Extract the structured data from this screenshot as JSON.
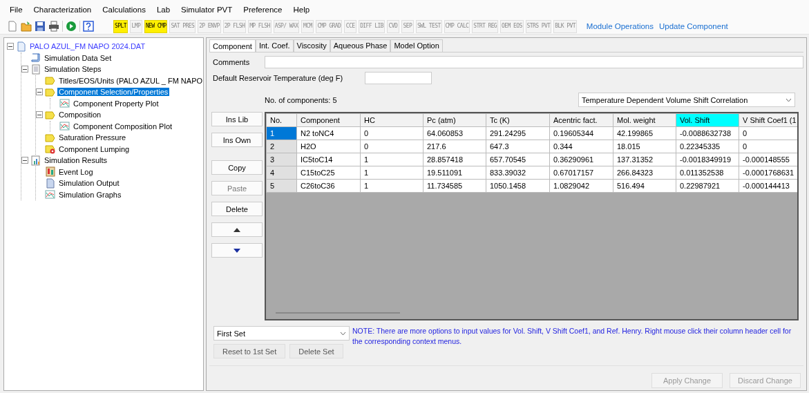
{
  "menu": [
    "File",
    "Characterization",
    "Calculations",
    "Lab",
    "Simulator PVT",
    "Preference",
    "Help"
  ],
  "toolbar": {
    "icons": [
      {
        "kind": "new"
      },
      {
        "kind": "open"
      },
      {
        "kind": "save"
      },
      {
        "kind": "print"
      },
      {
        "kind": "run"
      },
      {
        "kind": "help"
      }
    ],
    "tools": [
      {
        "label": "SPLT",
        "highlighted": true,
        "disabled": false
      },
      {
        "label": "LMP",
        "highlighted": false,
        "disabled": true
      },
      {
        "label": "NEW CMP",
        "highlighted": true,
        "disabled": false
      },
      {
        "label": "SAT PRES",
        "highlighted": false,
        "disabled": true
      },
      {
        "label": "2P ENVP",
        "highlighted": false,
        "disabled": true
      },
      {
        "label": "2P FLSH",
        "highlighted": false,
        "disabled": true
      },
      {
        "label": "MP FLSH",
        "highlighted": false,
        "disabled": true
      },
      {
        "label": "ASP/ WAX",
        "highlighted": false,
        "disabled": true
      },
      {
        "label": "MCM",
        "highlighted": false,
        "disabled": true
      },
      {
        "label": "CMP GRAD",
        "highlighted": false,
        "disabled": true
      },
      {
        "label": "CCE",
        "highlighted": false,
        "disabled": true
      },
      {
        "label": "DIFF LIB",
        "highlighted": false,
        "disabled": true
      },
      {
        "label": "CVD",
        "highlighted": false,
        "disabled": true
      },
      {
        "label": "SEP",
        "highlighted": false,
        "disabled": true
      },
      {
        "label": "SWL TEST",
        "highlighted": false,
        "disabled": true
      },
      {
        "label": "CMP CALC",
        "highlighted": false,
        "disabled": true
      },
      {
        "label": "STRT REG",
        "highlighted": false,
        "disabled": true
      },
      {
        "label": "OEM EOS",
        "highlighted": false,
        "disabled": true
      },
      {
        "label": "STRS PVT",
        "highlighted": false,
        "disabled": true
      },
      {
        "label": "BLK PVT",
        "highlighted": false,
        "disabled": true
      }
    ],
    "links": [
      "Module Operations",
      "Update Component"
    ]
  },
  "tree": [
    {
      "label": "PALO AZUL_FM NAPO 2024.DAT",
      "kind": "file",
      "expanded": true,
      "selected": false,
      "children": [
        {
          "label": "Simulation Data Set",
          "kind": "dataset",
          "selected": false
        },
        {
          "label": "Simulation Steps",
          "kind": "document",
          "expanded": true,
          "selected": false,
          "children": [
            {
              "label": "Titles/EOS/Units (PALO AZUL _ FM NAPO",
              "kind": "step",
              "selected": false
            },
            {
              "label": "Component Selection/Properties",
              "kind": "step",
              "expanded": true,
              "selected": true,
              "children": [
                {
                  "label": "Component Property Plot",
                  "kind": "plot",
                  "selected": false
                }
              ]
            },
            {
              "label": "Composition",
              "kind": "step",
              "expanded": true,
              "selected": false,
              "children": [
                {
                  "label": "Component Composition Plot",
                  "kind": "plot",
                  "selected": false
                }
              ]
            },
            {
              "label": "Saturation Pressure",
              "kind": "step",
              "selected": false
            },
            {
              "label": "Component Lumping",
              "kind": "error",
              "selected": false
            }
          ]
        },
        {
          "label": "Simulation Results",
          "kind": "results",
          "expanded": true,
          "selected": false,
          "children": [
            {
              "label": "Event Log",
              "kind": "log",
              "selected": false
            },
            {
              "label": "Simulation Output",
              "kind": "output",
              "selected": false
            },
            {
              "label": "Simulation Graphs",
              "kind": "plot",
              "selected": false
            }
          ]
        }
      ]
    }
  ],
  "tabs": [
    {
      "label": "Component",
      "selected": true
    },
    {
      "label": "Int. Coef.",
      "selected": false
    },
    {
      "label": "Viscosity",
      "selected": false
    },
    {
      "label": "Aqueous Phase",
      "selected": false
    },
    {
      "label": "Model Option",
      "selected": false
    }
  ],
  "comments_label": "Comments",
  "temperature_label": "Default Reservoir Temperature (deg F)",
  "component_count": "No. of components: 5",
  "correlation_dropdown": "Temperature Dependent Volume Shift Correlation",
  "side_buttons": [
    {
      "label": "Ins Lib",
      "kind": "text",
      "disabled": false
    },
    {
      "label": "Ins Own",
      "kind": "text",
      "disabled": false
    },
    {
      "label": "Copy",
      "kind": "text",
      "disabled": false
    },
    {
      "label": "Paste",
      "kind": "text",
      "disabled": true
    },
    {
      "label": "Delete",
      "kind": "text",
      "disabled": false
    },
    {
      "kind": "up",
      "disabled": false
    },
    {
      "kind": "down",
      "disabled": false
    }
  ],
  "table": {
    "columns": [
      {
        "label": "No.",
        "highlighted": false
      },
      {
        "label": "Component",
        "highlighted": false
      },
      {
        "label": "HC",
        "highlighted": false
      },
      {
        "label": "Pc (atm)",
        "highlighted": false
      },
      {
        "label": "Tc (K)",
        "highlighted": false
      },
      {
        "label": "Acentric fact.",
        "highlighted": false
      },
      {
        "label": "Mol. weight",
        "highlighted": false
      },
      {
        "label": "Vol. Shift",
        "highlighted": true
      },
      {
        "label": "V Shift Coef1 (1",
        "highlighted": false
      }
    ],
    "rows": [
      {
        "selected": true,
        "cells": [
          "1",
          "N2 toNC4",
          "0",
          "64.060853",
          "291.24295",
          "0.19605344",
          "42.199865",
          "-0.0088632738",
          "0"
        ]
      },
      {
        "selected": false,
        "cells": [
          "2",
          "H2O",
          "0",
          "217.6",
          "647.3",
          "0.344",
          "18.015",
          "0.22345335",
          "0"
        ]
      },
      {
        "selected": false,
        "cells": [
          "3",
          "IC5toC14",
          "1",
          "28.857418",
          "657.70545",
          "0.36290961",
          "137.31352",
          "-0.0018349919",
          "-0.000148555"
        ]
      },
      {
        "selected": false,
        "cells": [
          "4",
          "C15toC25",
          "1",
          "19.511091",
          "833.39032",
          "0.67017157",
          "266.84323",
          "0.011352538",
          "-0.0001768631"
        ]
      },
      {
        "selected": false,
        "cells": [
          "5",
          "C26toC36",
          "1",
          "11.734585",
          "1050.1458",
          "1.0829042",
          "516.494",
          "0.22987921",
          "-0.000144413"
        ]
      }
    ]
  },
  "set_dropdown": "First Set",
  "set_buttons": [
    "Reset to 1st Set",
    "Delete Set"
  ],
  "note": "NOTE:  There are more options to input values for Vol. Shift, V Shift Coef1, and Ref. Henry. Right mouse click their column header cell for the corresponding context menus.",
  "footer_buttons": [
    {
      "label": "Apply Change",
      "disabled": true
    },
    {
      "label": "Discard Change",
      "disabled": true
    }
  ]
}
